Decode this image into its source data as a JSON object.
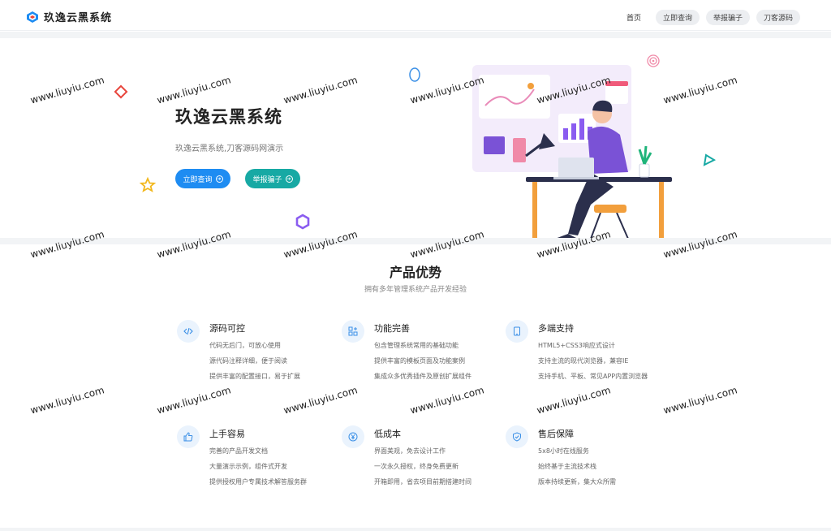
{
  "header": {
    "brand": "玖逸云黑系统",
    "nav": {
      "home": "首页",
      "query": "立即查询",
      "report": "举报骗子",
      "source": "刀客源码"
    }
  },
  "hero": {
    "title": "玖逸云黑系统",
    "subtitle": "玖逸云黑系统,刀客源码网演示",
    "btn_query": "立即查询",
    "btn_report": "举报骗子"
  },
  "features_section": {
    "title": "产品优势",
    "subtitle": "拥有多年管理系统产品开发经验",
    "items": [
      {
        "icon": "code-icon",
        "title": "源码可控",
        "lines": [
          "代码无后门，可放心使用",
          "源代码注释详细，便于阅读",
          "提供丰富的配置接口，易于扩展"
        ]
      },
      {
        "icon": "grid-icon",
        "title": "功能完善",
        "lines": [
          "包含管理系统常用的基础功能",
          "提供丰富的模板页面及功能案例",
          "集成众多优秀插件及原创扩展组件"
        ]
      },
      {
        "icon": "tablet-icon",
        "title": "多端支持",
        "lines": [
          "HTML5+CSS3响应式设计",
          "支持主流的现代浏览器，兼容IE",
          "支持手机、平板、常见APP内置浏览器"
        ]
      },
      {
        "icon": "thumbs-up-icon",
        "title": "上手容易",
        "lines": [
          "完善的产品开发文档",
          "大量演示示例，组件式开发",
          "提供授权用户专属技术解答服务群"
        ]
      },
      {
        "icon": "yen-icon",
        "title": "低成本",
        "lines": [
          "界面美观，免去设计工作",
          "一次永久授权，终身免费更新",
          "开箱即用，省去项目前期搭建时间"
        ]
      },
      {
        "icon": "shield-check-icon",
        "title": "售后保障",
        "lines": [
          "5x8小时在线服务",
          "始终基于主流技术栈",
          "版本持续更新，集大众所需"
        ]
      }
    ]
  },
  "watermark": "www.liuyiu.com",
  "colors": {
    "primary": "#1e8cf2",
    "teal": "#17a9a4",
    "icon_bg": "#eaf3fd"
  }
}
